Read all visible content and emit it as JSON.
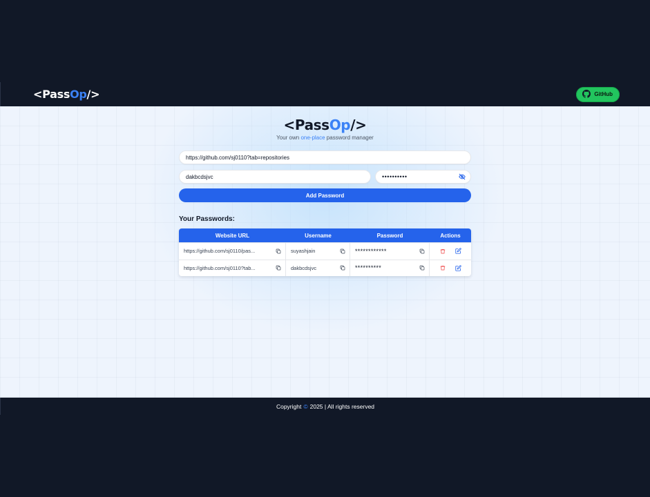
{
  "navbar": {
    "logo_open": "<Pass",
    "logo_accent": "Op",
    "logo_close": "/>",
    "github_label": "GitHub",
    "github_icon": "github-icon"
  },
  "hero": {
    "title_open": "<Pass",
    "title_accent": "Op",
    "title_close": "/>",
    "subtitle_pre": "Your own ",
    "subtitle_accent": "one-place",
    "subtitle_post": " password manager"
  },
  "form": {
    "url_value": "https://github.com/sj0110?tab=repositories",
    "username_value": "dakbcdsjvc",
    "password_masked": "••••••••••",
    "eye_icon": "eye-off-icon",
    "add_label": "Add Password"
  },
  "passwords": {
    "title": "Your Passwords:",
    "columns": [
      "Website URL",
      "Username",
      "Password",
      "Actions"
    ],
    "rows": [
      {
        "url": "https://github.com/sj0110/pas...",
        "username": "suyashjain",
        "password": "************"
      },
      {
        "url": "https://github.com/sj0110?tab...",
        "username": "dakbcdsjvc",
        "password": "**********"
      }
    ]
  },
  "footer": {
    "pre": "Copyright",
    "symbol": "©",
    "post": "2025 | All rights reserved"
  },
  "colors": {
    "accent": "#3b82f6",
    "primary_button": "#2563eb",
    "github_button": "#22c55e",
    "dark_bg": "#111827",
    "delete": "#ef4444"
  }
}
